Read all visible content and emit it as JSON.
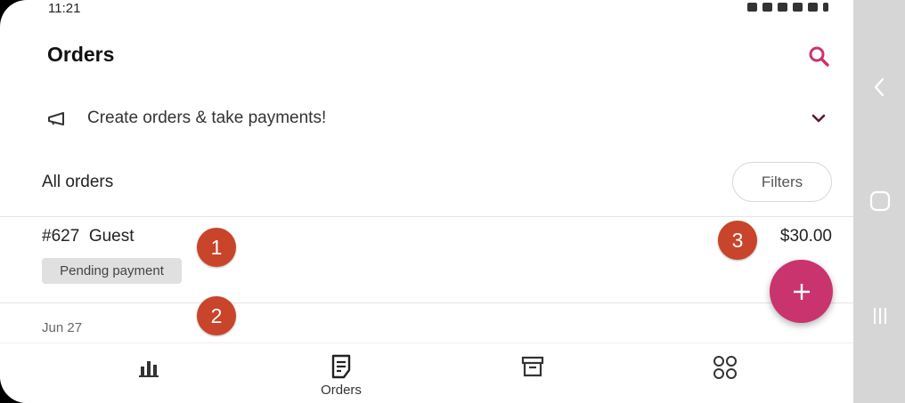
{
  "status_bar": {
    "time": "11:21"
  },
  "app_bar": {
    "title": "Orders",
    "search_icon": "search-icon"
  },
  "promo": {
    "icon": "megaphone-icon",
    "text": "Create orders & take payments!",
    "expand_icon": "chevron-down-icon"
  },
  "orders_section": {
    "title": "All orders",
    "filters_label": "Filters"
  },
  "orders": [
    {
      "number": "#627",
      "customer": "Guest",
      "title": "#627  Guest",
      "amount": "$30.00",
      "status": "Pending payment"
    }
  ],
  "date_group": "Jun 27",
  "markers": [
    "1",
    "2",
    "3"
  ],
  "fab": {
    "icon": "plus-icon"
  },
  "bottom_nav": [
    {
      "name": "stats",
      "icon": "bar-chart-icon",
      "label": ""
    },
    {
      "name": "orders",
      "icon": "document-icon",
      "label": "Orders"
    },
    {
      "name": "products",
      "icon": "archive-box-icon",
      "label": ""
    },
    {
      "name": "more",
      "icon": "grid-circles-icon",
      "label": ""
    }
  ],
  "colors": {
    "accent": "#c9336e",
    "marker": "#c8442a",
    "system_nav": "#d6d6d6"
  }
}
